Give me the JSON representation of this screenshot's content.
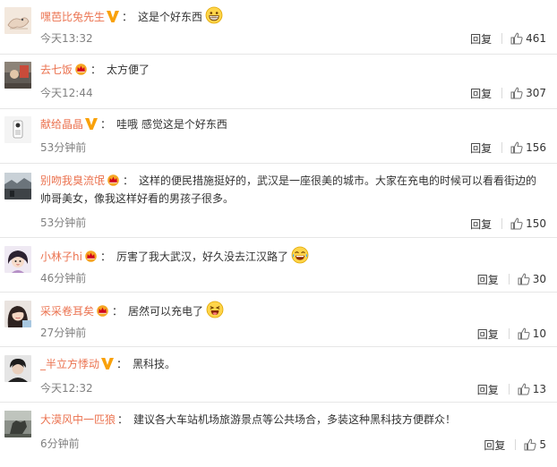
{
  "colors": {
    "author": "#eb7350",
    "time": "#808080",
    "text": "#333333",
    "divider": "#e6e6e6"
  },
  "actions": {
    "reply_label": "回复"
  },
  "comments": [
    {
      "author": "嘿芭比兔先生",
      "badge": "yellow-v-badge-icon",
      "colon": "：",
      "text": "这是个好东西",
      "emoji": "grin-emoji-icon",
      "time": "今天13:32",
      "likes": "461"
    },
    {
      "author": "去七饭",
      "badge": "crown-badge-icon",
      "colon": "：",
      "text": "太方便了",
      "time": "今天12:44",
      "likes": "307"
    },
    {
      "author": "献给晶晶",
      "badge": "yellow-v-badge-icon",
      "colon": "：",
      "text": "哇哦 感觉这是个好东西",
      "time": "53分钟前",
      "likes": "156"
    },
    {
      "author": "别吻我臭流氓",
      "badge": "crown-badge-icon",
      "colon": "：",
      "text": "这样的便民措施挺好的，武汉是一座很美的城市。大家在充电的时候可以看看街边的帅哥美女，像我这样好看的男孩子很多。",
      "time": "53分钟前",
      "likes": "150"
    },
    {
      "author": "小林子hi",
      "badge": "crown-badge-icon",
      "colon": "：",
      "text": "厉害了我大武汉，好久没去江汉路了",
      "emoji": "laugh-tears-emoji-icon",
      "time": "46分钟前",
      "likes": "30"
    },
    {
      "author": "采采卷耳矣",
      "badge": "crown-badge-icon",
      "colon": "：",
      "text": "居然可以充电了",
      "emoji": "laughing-emoji-icon",
      "time": "27分钟前",
      "likes": "10"
    },
    {
      "author": "_半立方悸动",
      "badge": "yellow-v-badge-icon",
      "colon": "：",
      "text": "黑科技。",
      "time": "今天12:32",
      "likes": "13"
    },
    {
      "author": "大漠风中一匹狼",
      "colon": "：",
      "text": "建议各大车站机场旅游景点等公共场合，多装这种黑科技方便群众！",
      "time": "6分钟前",
      "likes": "5"
    }
  ]
}
